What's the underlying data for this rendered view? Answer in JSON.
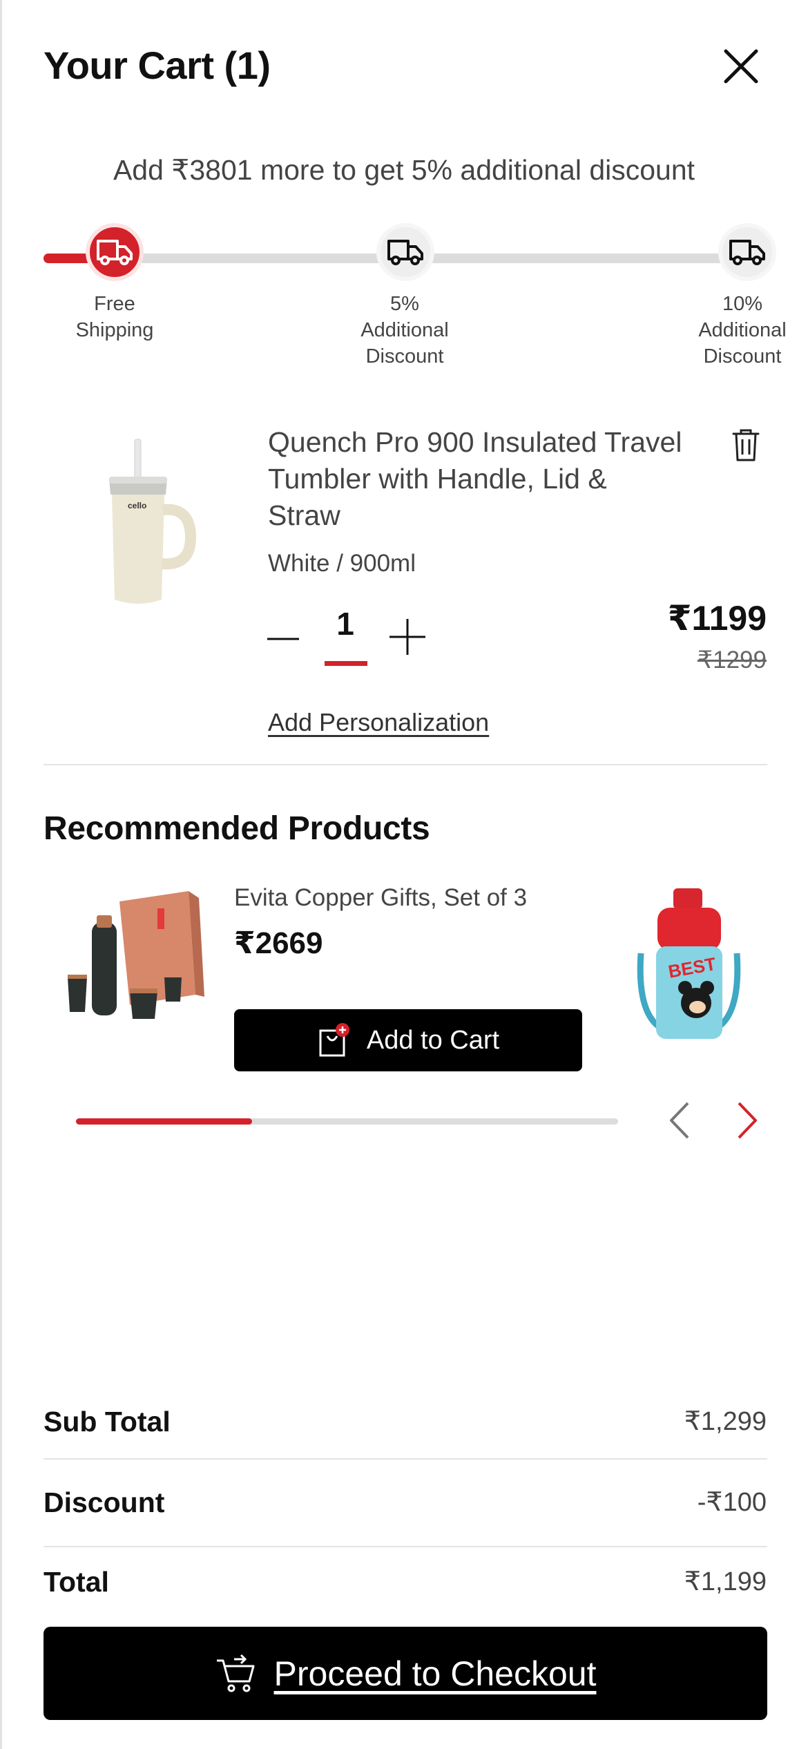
{
  "header": {
    "title": "Your Cart (1)",
    "close_icon": "close-icon"
  },
  "promo": {
    "message": "Add ₹3801 more to get 5% additional discount",
    "progress_percent": 10,
    "milestones": [
      {
        "label": "Free\nShipping",
        "icon": "truck-icon",
        "active": true
      },
      {
        "label": "5%\nAdditional\nDiscount",
        "icon": "truck-icon",
        "active": false
      },
      {
        "label": "10%\nAdditional\nDiscount",
        "icon": "truck-icon",
        "active": false
      }
    ]
  },
  "cart_item": {
    "title": "Quench Pro 900 Insulated Travel Tumbler with Handle, Lid & Straw",
    "variant": "White / 900ml",
    "quantity": "1",
    "price": "₹1199",
    "original_price": "₹1299",
    "personalization_link": "Add Personalization",
    "image_brand": "cello"
  },
  "recommended": {
    "title": "Recommended Products",
    "items": [
      {
        "name": "Evita Copper Gifts, Set of 3",
        "price": "₹2669",
        "button_label": "Add to Cart"
      }
    ],
    "next_preview_text": "BEST",
    "scroll_progress": 0.33
  },
  "summary": {
    "subtotal_label": "Sub Total",
    "subtotal_value": "₹1,299",
    "discount_label": "Discount",
    "discount_value": "-₹100",
    "total_label": "Total",
    "total_value": "₹1,199"
  },
  "checkout": {
    "label": "Proceed to Checkout",
    "icon": "cart-arrow-icon"
  },
  "colors": {
    "accent": "#d3222a",
    "primary_button": "#000000"
  }
}
